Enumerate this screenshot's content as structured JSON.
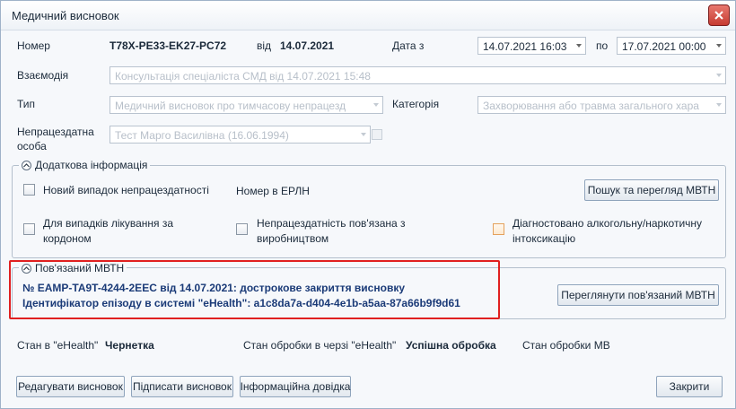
{
  "window": {
    "title": "Медичний висновок"
  },
  "header": {
    "number_label": "Номер",
    "number_value": "T78X-PE33-EK27-PC72",
    "from_label": "від",
    "from_date": "14.07.2021",
    "date_from_label": "Дата з",
    "date_from_value": "14.07.2021 16:03",
    "date_to_label": "по",
    "date_to_value": "17.07.2021 00:00"
  },
  "fields": {
    "interaction_label": "Взаємодія",
    "interaction_value": "Консультація спеціаліста СМД від 14.07.2021 15:48",
    "type_label": "Тип",
    "type_value": "Медичний висновок про тимчасову непрацезд",
    "category_label": "Категорія",
    "category_value": "Захворювання або травма загального хара",
    "person_label_1": "Непрацездатна",
    "person_label_2": "особа",
    "person_value": "Тест Марго Василівна (16.06.1994)"
  },
  "additional": {
    "title": "Додаткова інформація",
    "new_case_label": "Новий випадок непрацездатності",
    "erln_label": "Номер в ЕРЛН",
    "search_button": "Пошук та перегляд МВТН",
    "abroad_label_1": "Для випадків лікування за",
    "abroad_label_2": "кордоном",
    "production_label_1": "Непрацездатність пов'язана з",
    "production_label_2": "виробництвом",
    "alcohol_label_1": "Діагностовано алкогольну/наркотичну",
    "alcohol_label_2": "інтоксикацію"
  },
  "related": {
    "title": "Пов'язаний МВТН",
    "line1": "№ EAMP-TA9T-4244-2EEC від 14.07.2021: дострокове закриття висновку",
    "line2": "Ідентифікатор епізоду в системі \"eHealth\": a1c8da7a-d404-4e1b-a5aa-87a66b9f9d61",
    "view_button": "Переглянути пов'язаний МВТН"
  },
  "status": {
    "ehealth_label": "Стан в \"eHealth\"",
    "ehealth_value": "Чернетка",
    "queue_label": "Стан обробки в черзі \"eHealth\"",
    "queue_value": "Успішна обробка",
    "mv_label": "Стан обробки МВ"
  },
  "footer": {
    "edit_button": "Редагувати висновок",
    "sign_button": "Підписати висновок",
    "info_button": "Інформаційна довідка",
    "close_button": "Закрити"
  },
  "colors": {
    "accent_red": "#e02020",
    "link_blue": "#1b3b78"
  },
  "icons": {
    "close": "close-icon",
    "expander": "chevron-up-icon"
  }
}
